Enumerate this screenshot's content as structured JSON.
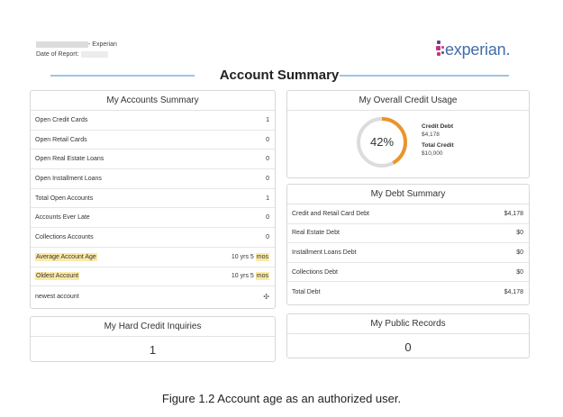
{
  "header": {
    "name_suffix": "- Experian",
    "date_label": "Date of Report:",
    "logo_text": "experian."
  },
  "title": "Account Summary",
  "accounts_summary": {
    "title": "My Accounts Summary",
    "rows": [
      {
        "label": "Open Credit Cards",
        "value": "1"
      },
      {
        "label": "Open Retail Cards",
        "value": "0"
      },
      {
        "label": "Open Real Estate Loans",
        "value": "0"
      },
      {
        "label": "Open Installment Loans",
        "value": "0"
      },
      {
        "label": "Total Open Accounts",
        "value": "1"
      },
      {
        "label": "Accounts Ever Late",
        "value": "0"
      },
      {
        "label": "Collections Accounts",
        "value": "0"
      },
      {
        "label": "Average Account Age",
        "value_main": "10 yrs 5",
        "value_unit": "mos"
      },
      {
        "label": "Oldest Account",
        "value_main": "10 yrs 5",
        "value_unit": "mos"
      },
      {
        "label": "newest account"
      }
    ]
  },
  "hard_inquiries": {
    "title": "My Hard Credit Inquiries",
    "value": "1"
  },
  "credit_usage": {
    "title": "My Overall Credit Usage",
    "percent_label": "42%",
    "percent": 42,
    "credit_debt_label": "Credit Debt",
    "credit_debt_value": "$4,178",
    "total_credit_label": "Total Credit",
    "total_credit_value": "$10,000",
    "arc_color": "#e9952c",
    "track_color": "#dcdcdc"
  },
  "debt_summary": {
    "title": "My Debt Summary",
    "rows": [
      {
        "label": "Credit and Retail Card Debt",
        "value": "$4,178"
      },
      {
        "label": "Real Estate Debt",
        "value": "$0"
      },
      {
        "label": "Installment Loans Debt",
        "value": "$0"
      },
      {
        "label": "Collections Debt",
        "value": "$0"
      },
      {
        "label": "Total Debt",
        "value": "$4,178"
      }
    ]
  },
  "public_records": {
    "title": "My Public Records",
    "value": "0"
  },
  "caption": "Figure 1.2 Account age as an authorized user.",
  "colors": {
    "accent_line": "#9ec4e8",
    "highlight": "#fbe9a6",
    "logo_blue": "#426da9"
  },
  "icons": {
    "newest_account_icon": "gear-icon"
  }
}
